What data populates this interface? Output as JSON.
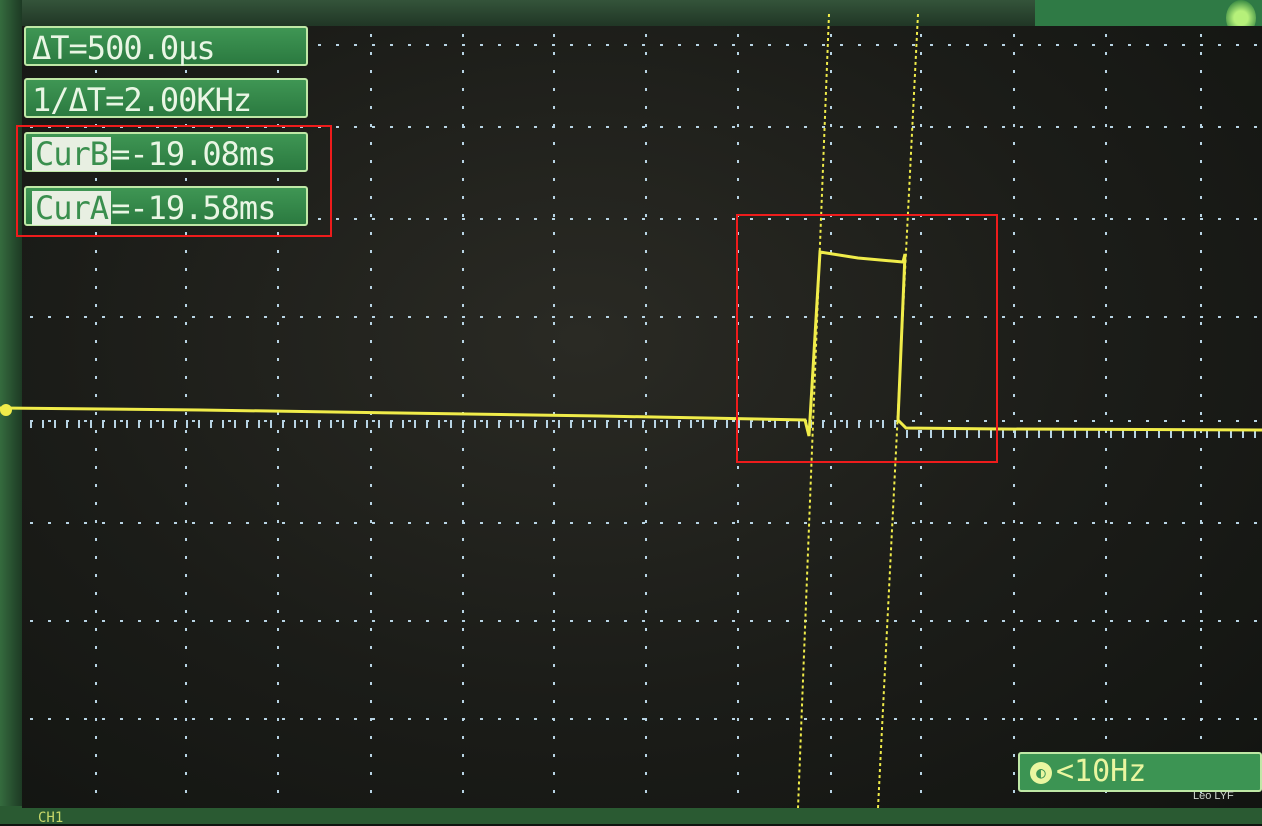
{
  "readouts": {
    "delta_t": "ΔT=500.0μs",
    "inv_delta_t": "1/ΔT=2.00KHz",
    "cur_b_label": "CurB",
    "cur_b_value": "=-19.08ms",
    "cur_a_label": "CurA",
    "cur_a_value": "=-19.58ms"
  },
  "trigger": {
    "icon": "trigger-icon",
    "text": "<10Hz"
  },
  "watermark": "Leo LYF",
  "bottom_text": "CH1",
  "colors": {
    "trace": "#f0ec4a",
    "grid": "#b8d4e4",
    "highlight": "#ee1c1c",
    "readout_bg": "#3f9654"
  }
}
